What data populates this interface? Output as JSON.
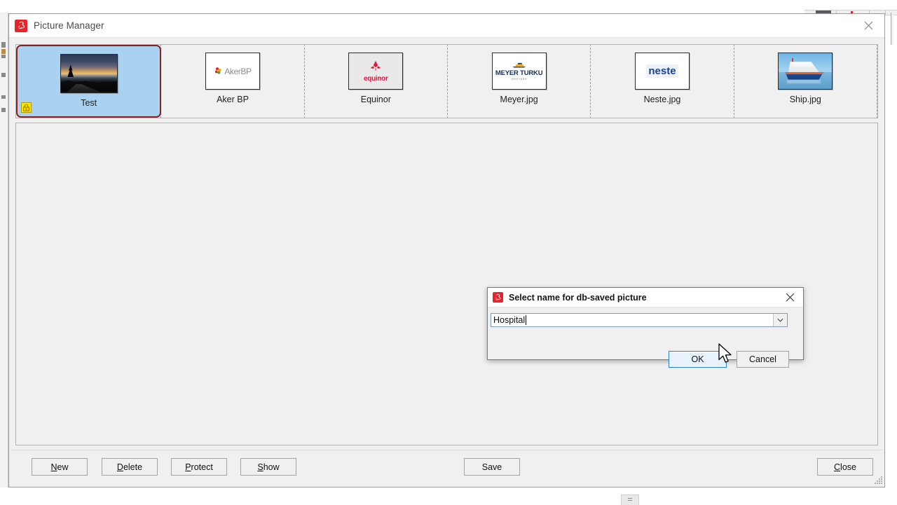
{
  "window": {
    "title": "Picture Manager",
    "app_icon": "recycle-spiral-icon",
    "close_icon": "close-icon"
  },
  "thumbnails": [
    {
      "label": "Test",
      "art": "sunset-landscape-photo",
      "selected": true,
      "protected": true,
      "lock_icon": "padlock-icon"
    },
    {
      "label": "Aker BP",
      "art": "akerbp-logo",
      "selected": false,
      "protected": false,
      "logo_text": "AkerBP"
    },
    {
      "label": "Equinor",
      "art": "equinor-logo",
      "selected": false,
      "protected": false,
      "logo_text": "equinor"
    },
    {
      "label": "Meyer.jpg",
      "art": "meyer-turku-logo",
      "selected": false,
      "protected": false,
      "logo_text": "MEYER TURKU",
      "logo_subtext": "SHIPYARD"
    },
    {
      "label": "Neste.jpg",
      "art": "neste-logo",
      "selected": false,
      "protected": false,
      "logo_text": "neste"
    },
    {
      "label": "Ship.jpg",
      "art": "cruise-ship-photo",
      "selected": false,
      "protected": false
    }
  ],
  "toolbar": {
    "new_label_pre": "",
    "new_accel": "N",
    "new_label_post": "ew",
    "delete_label_pre": "",
    "delete_accel": "D",
    "delete_label_post": "elete",
    "protect_label_pre": "",
    "protect_accel": "P",
    "protect_label_post": "rotect",
    "show_label_pre": "",
    "show_accel": "S",
    "show_label_post": "how",
    "save_label": "Save",
    "close_label_pre": "",
    "close_accel": "C",
    "close_label_post": "lose"
  },
  "dialog": {
    "title": "Select name for db-saved picture",
    "app_icon": "recycle-spiral-icon",
    "close_icon": "close-icon",
    "input_value": "Hospital",
    "dropdown_icon": "chevron-down-icon",
    "ok_label": "OK",
    "cancel_label": "Cancel"
  },
  "colors": {
    "selection_fill": "#a8d2f0",
    "selection_border": "#8b2020",
    "accent_blue": "#2a7fd4",
    "app_icon_red": "#e8232a",
    "lock_yellow": "#ffe400"
  }
}
